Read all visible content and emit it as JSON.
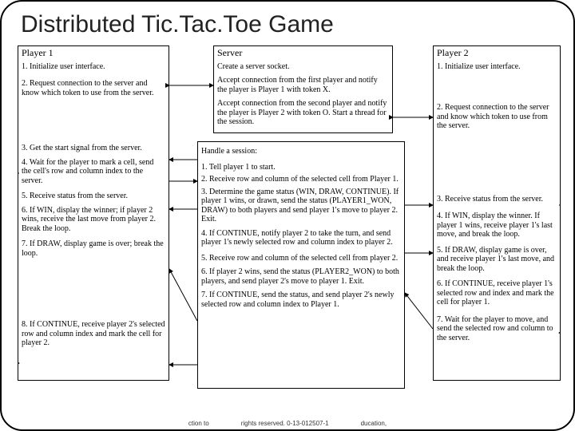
{
  "title": "Distributed Tic.Tac.Toe Game",
  "player1": {
    "header": "Player 1",
    "s1": "1. Initialize user interface.",
    "s2": "2. Request connection to the server and know which token to use from the server.",
    "s3": "3. Get the start signal from the server.",
    "s4": "4. Wait for the player to mark a cell, send the cell's row and column index to the server.",
    "s5": "5. Receive status from the server.",
    "s6": "6. If WIN, display the winner; if player 2 wins, receive the last move from player 2. Break the loop.",
    "s7": "7. If DRAW, display game is over; break the loop.",
    "s8": "8. If CONTINUE, receive player 2's selected row and column index and mark the cell for player 2."
  },
  "server": {
    "header": "Server",
    "sa": "Create a server socket.",
    "sb": "Accept connection from the first player and notify the player is Player 1 with token X.",
    "sc": "Accept connection from the second player and notify the player is Player 2 with token O. Start a thread for the session."
  },
  "session": {
    "h": "Handle a session:",
    "t1": "1. Tell player 1 to start.",
    "t2": "2. Receive row and column of the selected cell from Player 1.",
    "t3": "3. Determine the game status (WIN, DRAW, CONTINUE). If player 1 wins, or drawn, send the status (PLAYER1_WON, DRAW) to both players and send player 1's move to player 2. Exit.",
    "t4": "4. If CONTINUE, notify player 2 to take the turn, and send player 1's newly selected row and column index to player 2.",
    "t5": "5. Receive row and column of the selected cell from player 2.",
    "t6": "6. If player 2 wins, send the status (PLAYER2_WON) to both players, and send player 2's move to player 1. Exit.",
    "t7": "7. If CONTINUE, send the status, and send player 2's newly selected row and column index to Player 1."
  },
  "player2": {
    "header": "Player 2",
    "s1": "1. Initialize user interface.",
    "s2": "2. Request connection to the server and know which token to use from the server.",
    "s3": "3. Receive status from the server.",
    "s4": "4. If WIN, display the winner. If player 1 wins, receive player 1's last move, and break the loop.",
    "s5": "5. If DRAW, display game is over, and receive player 1's last move, and break the loop.",
    "s6": "6. If CONTINUE, receive player 1's selected row and index and mark the cell for player 1.",
    "s7": "7. Wait for the player to move, and send the selected row and column to the server."
  },
  "footer_a": "ction to",
  "footer_b": "rights reserved. 0-13-012507-1",
  "footer_c": "ducation,"
}
